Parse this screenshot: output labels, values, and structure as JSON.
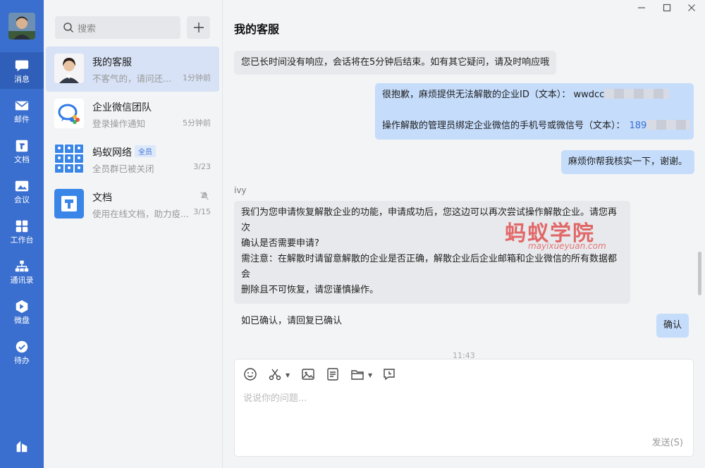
{
  "nav": {
    "items": [
      {
        "label": "消息",
        "icon": "chat-bubble-icon"
      },
      {
        "label": "邮件",
        "icon": "mail-icon"
      },
      {
        "label": "文档",
        "icon": "document-icon"
      },
      {
        "label": "会议",
        "icon": "meeting-icon"
      },
      {
        "label": "工作台",
        "icon": "workbench-icon"
      },
      {
        "label": "通讯录",
        "icon": "contacts-icon"
      },
      {
        "label": "微盘",
        "icon": "drive-icon"
      },
      {
        "label": "待办",
        "icon": "todo-icon"
      }
    ]
  },
  "contacts": {
    "search_placeholder": "搜索",
    "conversations": [
      {
        "name": "我的客服",
        "snippet": "不客气的，请问还...",
        "time": "1分钟前"
      },
      {
        "name": "企业微信团队",
        "snippet": "登录操作通知",
        "time": "5分钟前"
      },
      {
        "name": "蚂蚁网络",
        "badge": "全员",
        "snippet": "全员群已被关闭",
        "time": "3/23"
      },
      {
        "name": "文档",
        "snippet": "使用在线文档，助力疫...",
        "time": "3/15"
      }
    ]
  },
  "chat": {
    "title": "我的客服",
    "messages": {
      "m1": "您已长时间没有响应，会话将在5分钟后结束。如有其它疑问，请及时响应哦",
      "m2_line1": "很抱歉，麻烦提供无法解散的企业ID（文本）： wwdcc",
      "m2_line2": "操作解散的管理员绑定企业微信的手机号或微信号（文本）：",
      "m2_phone": "189",
      "m3": "麻烦你帮我核实一下，谢谢。",
      "sender": "ivy",
      "m4_l1": "我们为您申请恢复解散企业的功能，申请成功后，您这边可以再次尝试操作解散企业。请您再次",
      "m4_l2": "确认是否需要申请?",
      "m4_l3": "需注意：在解散时请留意解散的企业是否正确，解散企业后企业邮箱和企业微信的所有数据都会",
      "m4_l4": "删除且不可恢复，请您谨慎操作。",
      "m4_l5": "如已确认，请回复已确认",
      "m5": "确认"
    },
    "timestamp": "11:43",
    "watermark_title": "蚂蚁学院",
    "watermark_sub": "mayixueyuan.com"
  },
  "composer": {
    "placeholder": "说说你的问题...",
    "send_label": "发送(S)"
  }
}
